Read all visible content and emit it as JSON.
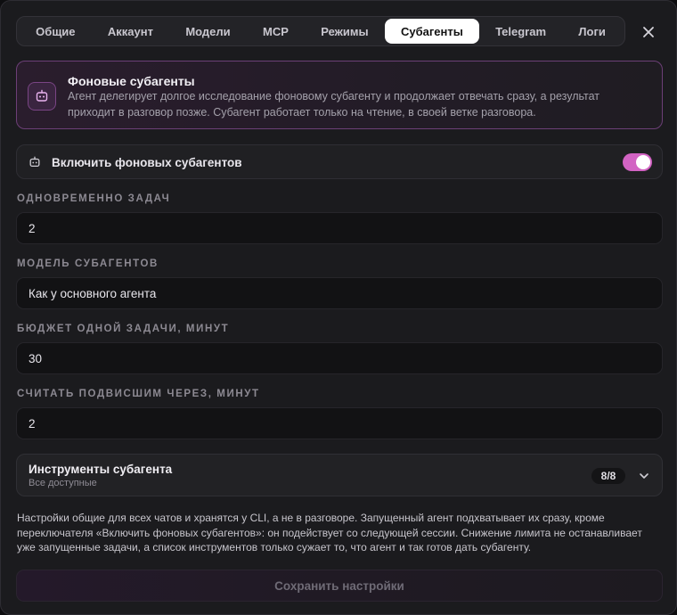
{
  "tabs": [
    {
      "label": "Общие"
    },
    {
      "label": "Аккаунт"
    },
    {
      "label": "Модели"
    },
    {
      "label": "MCP"
    },
    {
      "label": "Режимы"
    },
    {
      "label": "Субагенты",
      "active": true
    },
    {
      "label": "Telegram"
    },
    {
      "label": "Логи"
    }
  ],
  "info": {
    "title": "Фоновые субагенты",
    "description": "Агент делегирует долгое исследование фоновому субагенту и продолжает отвечать сразу, а результат приходит в разговор позже. Субагент работает только на чтение, в своей ветке разговора.",
    "icon": "robot-icon"
  },
  "toggle": {
    "label": "Включить фоновых субагентов",
    "enabled": true,
    "icon": "robot-icon"
  },
  "fields": [
    {
      "label": "ОДНОВРЕМЕННО ЗАДАЧ",
      "value": "2"
    },
    {
      "label": "МОДЕЛЬ СУБАГЕНТОВ",
      "value": "Как у основного агента"
    },
    {
      "label": "БЮДЖЕТ ОДНОЙ ЗАДАЧИ, МИНУТ",
      "value": "30"
    },
    {
      "label": "СЧИТАТЬ ПОДВИСШИМ ЧЕРЕЗ, МИНУТ",
      "value": "2"
    }
  ],
  "tools": {
    "title": "Инструменты субагента",
    "subtitle": "Все доступные",
    "badge": "8/8"
  },
  "note": "Настройки общие для всех чатов и хранятся у CLI, а не в разговоре. Запущенный агент подхватывает их сразу, кроме переключателя «Включить фоновых субагентов»: он подействует со следующей сессии. Снижение лимита не останавливает уже запущенные задачи, а список инструментов только сужает то, что агент и так готов дать субагенту.",
  "save_label": "Сохранить настройки",
  "colors": {
    "accent": "#d263c3",
    "accent_border": "#6c3f77"
  }
}
